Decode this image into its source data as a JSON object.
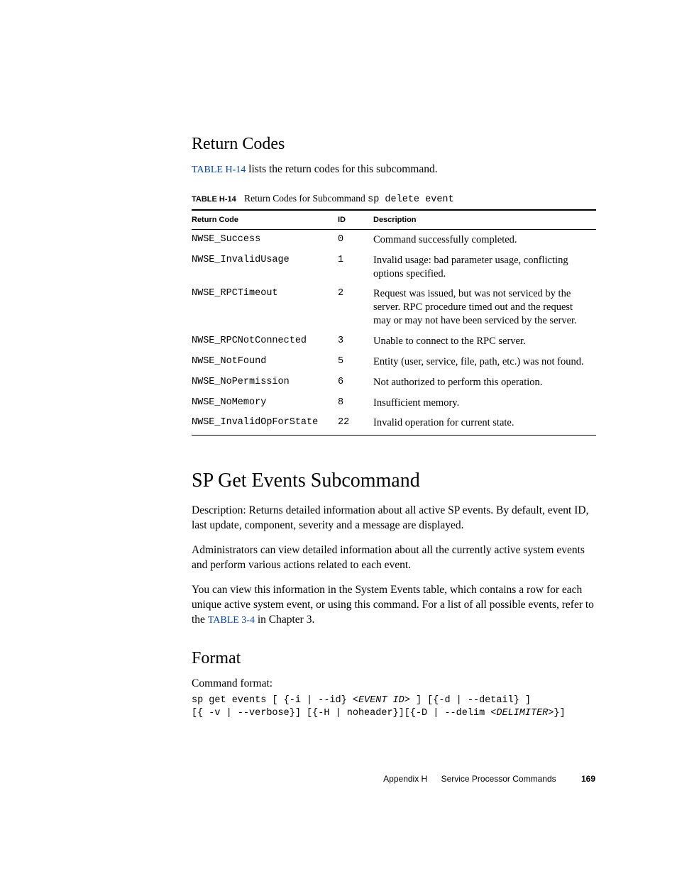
{
  "section1": {
    "title": "Return Codes",
    "intro_prefix": "TABLE H-14",
    "intro_suffix": " lists the return codes for this subcommand.",
    "table_label": "TABLE H-14",
    "table_caption": "Return Codes for Subcommand ",
    "table_cmd": "sp delete event",
    "columns": {
      "code": "Return Code",
      "id": "ID",
      "desc": "Description"
    },
    "rows": [
      {
        "code": "NWSE_Success",
        "id": "0",
        "desc": "Command successfully completed."
      },
      {
        "code": "NWSE_InvalidUsage",
        "id": "1",
        "desc": "Invalid usage: bad parameter usage, conflicting options specified."
      },
      {
        "code": "NWSE_RPCTimeout",
        "id": "2",
        "desc": "Request was issued, but was not serviced by the server. RPC procedure timed out and the request may or may not have been serviced by the server."
      },
      {
        "code": "NWSE_RPCNotConnected",
        "id": "3",
        "desc": "Unable to connect to the RPC server."
      },
      {
        "code": "NWSE_NotFound",
        "id": "5",
        "desc": "Entity (user, service, file, path, etc.) was not found."
      },
      {
        "code": "NWSE_NoPermission",
        "id": "6",
        "desc": "Not authorized to perform this operation."
      },
      {
        "code": "NWSE_NoMemory",
        "id": "8",
        "desc": "Insufficient memory."
      },
      {
        "code": "NWSE_InvalidOpForState",
        "id": "22",
        "desc": "Invalid operation for current state."
      }
    ]
  },
  "section2": {
    "title": "SP Get Events Subcommand",
    "para1": "Description: Returns detailed information about all active SP events. By default, event ID, last update, component, severity and a message are displayed.",
    "para2": "Administrators can view detailed information about all the currently active system events and perform various actions related to each event.",
    "para3_pre": "You can view this information in the System Events table, which contains a row for each unique active system event, or using this command. For a list of all possible events, refer to the ",
    "para3_link": "TABLE 3-4",
    "para3_post": " in Chapter 3."
  },
  "section3": {
    "title": "Format",
    "lead": "Command format:",
    "cmd_plain1": "sp get events [ {-i | --id} <",
    "cmd_ital1": "EVENT ID",
    "cmd_plain2": "> ] [{-d | --detail} ]\n[{ -v | --verbose}] [{-H | noheader}][{-D | --delim <",
    "cmd_ital2": "DELIMITER",
    "cmd_plain3": ">}]"
  },
  "footer": {
    "appendix": "Appendix H",
    "title": "Service Processor Commands",
    "page": "169"
  }
}
